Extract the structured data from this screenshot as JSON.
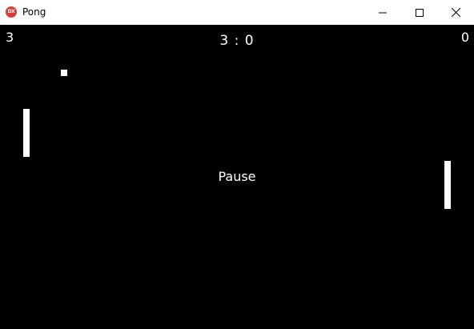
{
  "window": {
    "title": "Pong",
    "icon_label": "DX",
    "icon": "directx-app-icon",
    "controls": {
      "minimize": "minimize-icon",
      "maximize": "maximize-icon",
      "close": "close-icon"
    }
  },
  "game": {
    "score_left": "3",
    "score_right": "0",
    "score_center": "3 : 0",
    "status": "Pause",
    "colors": {
      "background": "#000000",
      "foreground": "#ffffff"
    }
  }
}
